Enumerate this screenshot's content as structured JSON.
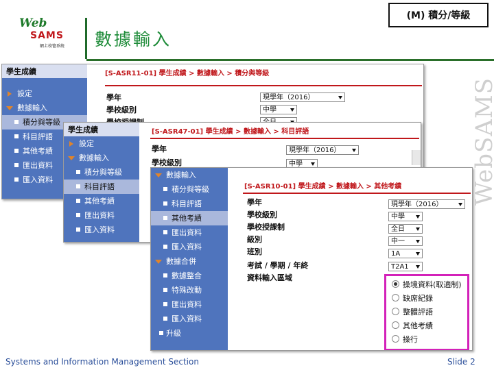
{
  "header": {
    "logo_web": "Web",
    "logo_sams": "SAMS",
    "logo_sub": "網上校管系統",
    "title": "數據輸入",
    "badge": "(M) 積分/等級"
  },
  "window1": {
    "sidebar_head": "學生成績",
    "nav": [
      {
        "label": "設定"
      },
      {
        "label": "數據輸入"
      },
      {
        "label": "積分與等級"
      },
      {
        "label": "科目評語"
      },
      {
        "label": "其他考績"
      },
      {
        "label": "匯出資料"
      },
      {
        "label": "匯入資料"
      }
    ],
    "breadcrumb": "[S-ASR11-01] 學生成績 > 數據輸入 > 積分與等級",
    "fields": [
      {
        "label": "學年",
        "value": "現學年（2016）"
      },
      {
        "label": "學校級別",
        "value": "中學"
      },
      {
        "label": "學校授課制",
        "value": "全日"
      }
    ]
  },
  "window2": {
    "sidebar_head": "學生成績",
    "nav": [
      {
        "label": "設定"
      },
      {
        "label": "數據輸入"
      },
      {
        "label": "積分與等級"
      },
      {
        "label": "科目評語"
      },
      {
        "label": "其他考績"
      },
      {
        "label": "匯出資料"
      },
      {
        "label": "匯入資料"
      }
    ],
    "breadcrumb": "[S-ASR47-01] 學生成績 > 數據輸入 > 科目評語",
    "fields": [
      {
        "label": "學年",
        "value": "現學年（2016）"
      },
      {
        "label": "學校級別",
        "value": "中學"
      }
    ]
  },
  "window3": {
    "nav": [
      {
        "label": "數據輸入"
      },
      {
        "label": "積分與等級"
      },
      {
        "label": "科目評語"
      },
      {
        "label": "其他考績"
      },
      {
        "label": "匯出資料"
      },
      {
        "label": "匯入資料"
      },
      {
        "label": "數據合併"
      },
      {
        "label": "數據整合"
      },
      {
        "label": "特殊改動"
      },
      {
        "label": "匯出資料"
      },
      {
        "label": "匯入資料"
      },
      {
        "label": "升級"
      }
    ],
    "breadcrumb": "[S-ASR10-01] 學生成績 > 數據輸入 > 其他考績",
    "fields": [
      {
        "label": "學年",
        "value": "現學年（2016）"
      },
      {
        "label": "學校級別",
        "value": "中學"
      },
      {
        "label": "學校授課制",
        "value": "全日"
      },
      {
        "label": "級別",
        "value": "中一"
      },
      {
        "label": "班別",
        "value": "1A"
      },
      {
        "label": "考試 / 學期 / 年終",
        "value": "T2A1"
      },
      {
        "label": "資料輸入區域",
        "value": ""
      }
    ],
    "radio_options": [
      {
        "label": "操境資料(取適制)",
        "selected": true
      },
      {
        "label": "缺席紀錄",
        "selected": false
      },
      {
        "label": "整體評語",
        "selected": false
      },
      {
        "label": "其他考績",
        "selected": false
      },
      {
        "label": "操行",
        "selected": false
      }
    ]
  },
  "footer": {
    "left": "Systems and Information Management Section",
    "right": "Slide 2"
  },
  "watermark": "WebSAMS",
  "colors": {
    "sidebar": "#4f74bd",
    "breadcrumb": "#c0171b",
    "title": "#1f8c3a",
    "highlight": "#d321b9"
  }
}
